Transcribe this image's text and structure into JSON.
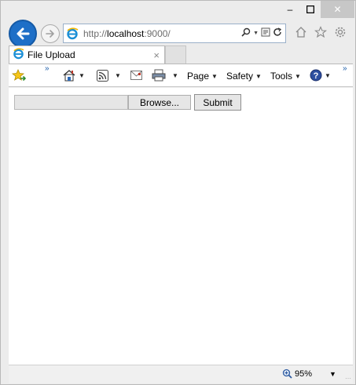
{
  "window": {
    "minimize_glyph": "–",
    "close_glyph": "✕",
    "accent": "#1e6fc7"
  },
  "address": {
    "scheme": "http://",
    "host": "localhost",
    "rest": ":9000/"
  },
  "tab": {
    "title": "File Upload",
    "close_glyph": "×"
  },
  "commandbar": {
    "page_label": "Page",
    "safety_label": "Safety",
    "tools_label": "Tools"
  },
  "form": {
    "browse_label": "Browse...",
    "submit_label": "Submit"
  },
  "status": {
    "zoom": "95%"
  }
}
